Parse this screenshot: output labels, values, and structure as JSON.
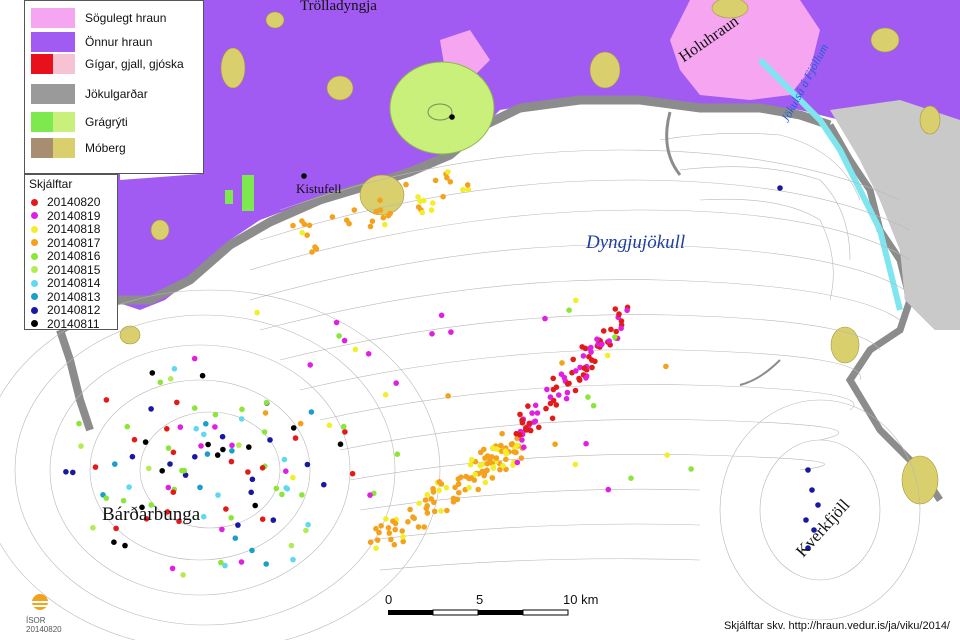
{
  "legend": {
    "geology": [
      {
        "label": "Sögulegt hraun",
        "colors": [
          "#f6a6f0"
        ]
      },
      {
        "label": "Önnur hraun",
        "colors": [
          "#a25bf2"
        ]
      },
      {
        "label": "Gígar, gjall, gjóska",
        "colors": [
          "#e8111b",
          "#f7c3d4"
        ]
      },
      {
        "label": "Jökulgarðar",
        "colors": [
          "#9a9a9a"
        ]
      },
      {
        "label": "Grágrýti",
        "colors": [
          "#7ee84f",
          "#c8f07a"
        ]
      },
      {
        "label": "Móberg",
        "colors": [
          "#a88e70",
          "#d9cf6c"
        ]
      }
    ],
    "quake_title": "Skjálftar",
    "quake_dates": [
      {
        "label": "20140820",
        "color": "#e21a1a"
      },
      {
        "label": "20140819",
        "color": "#e020e0"
      },
      {
        "label": "20140818",
        "color": "#f2ee2a"
      },
      {
        "label": "20140817",
        "color": "#f4a21e"
      },
      {
        "label": "20140816",
        "color": "#8ce63a"
      },
      {
        "label": "20140815",
        "color": "#b3ec52"
      },
      {
        "label": "20140814",
        "color": "#5fd8f0"
      },
      {
        "label": "20140813",
        "color": "#1aa0c8"
      },
      {
        "label": "20140812",
        "color": "#1818a0"
      },
      {
        "label": "20140811",
        "color": "#000000"
      }
    ]
  },
  "places": {
    "trolladyngja": "Trölladyngja",
    "kistufell": "Kistufell",
    "holuhraun": "Holuhraun",
    "jokulsa": "Jökulsá á Fjöllum",
    "dyngjujokull": "Dyngjujökull",
    "bardarbunga": "Bárðarbunga",
    "kverkfjoll": "Kverkfjöll"
  },
  "scale": {
    "ticks": [
      "0",
      "5",
      "10 km"
    ]
  },
  "credit": "Skjálftar  skv.  http://hraun.vedur.is/ja/viku/2014/",
  "logo": {
    "name": "ÍSOR",
    "date": "20140820"
  },
  "colors": {
    "glacier": "#ffffff",
    "contour": "#b8b8b8",
    "lava_other": "#a25bf2",
    "lava_historic": "#f6a6f0",
    "moraine": "#9a9a9a",
    "river": "#7fe6f0"
  }
}
